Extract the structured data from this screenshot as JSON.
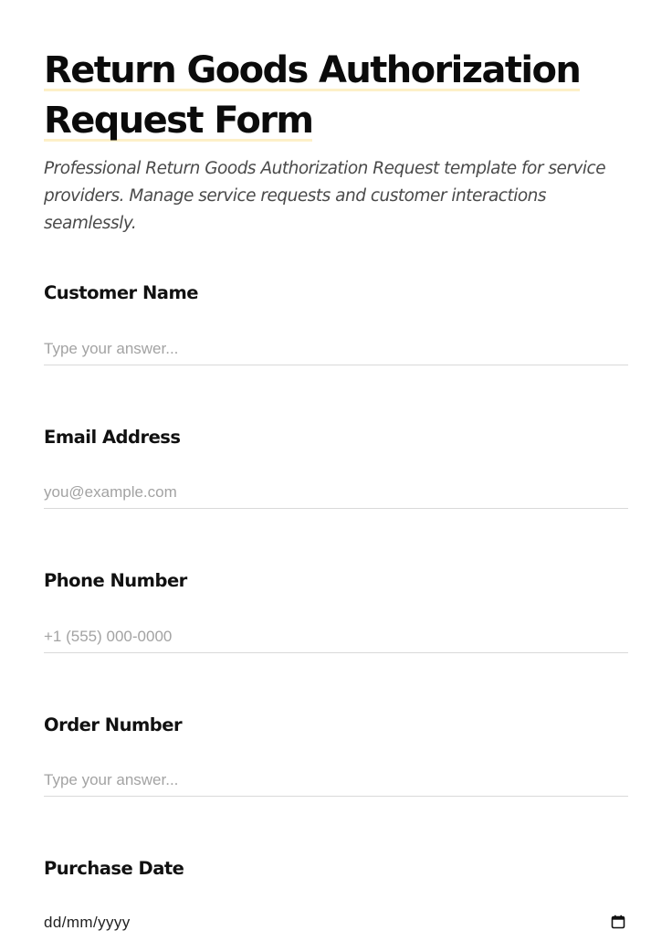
{
  "header": {
    "title_line1": "Return Goods Authorization",
    "title_line2": "Request Form",
    "description": "Professional Return Goods Authorization Request template for service providers. Manage service requests and customer interactions seamlessly."
  },
  "fields": {
    "customer_name": {
      "label": "Customer Name",
      "placeholder": "Type your answer...",
      "value": ""
    },
    "email": {
      "label": "Email Address",
      "placeholder": "you@example.com",
      "value": ""
    },
    "phone": {
      "label": "Phone Number",
      "placeholder": "+1 (555) 000-0000",
      "value": ""
    },
    "order_number": {
      "label": "Order Number",
      "placeholder": "Type your answer...",
      "value": ""
    },
    "purchase_date": {
      "label": "Purchase Date",
      "format_hint": "dd/mm/yyyy",
      "icon": "calendar-icon"
    }
  },
  "colors": {
    "title_highlight": "#fdf0c8",
    "text": "#111111",
    "placeholder": "#a3a3a3",
    "input_border": "#d9d9d9",
    "description": "#4a4a4a"
  }
}
